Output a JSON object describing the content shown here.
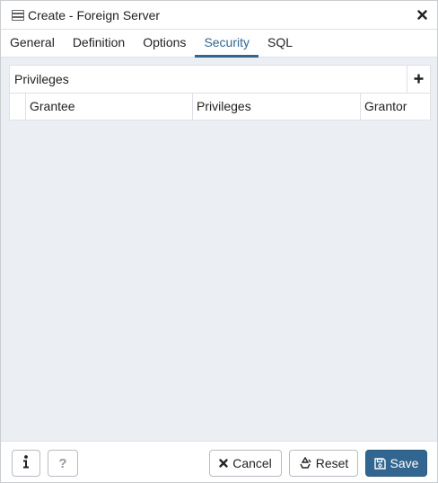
{
  "window": {
    "title": "Create - Foreign Server",
    "icon": "foreign-server-icon"
  },
  "tabs": [
    {
      "label": "General",
      "active": false
    },
    {
      "label": "Definition",
      "active": false
    },
    {
      "label": "Options",
      "active": false
    },
    {
      "label": "Security",
      "active": true
    },
    {
      "label": "SQL",
      "active": false
    }
  ],
  "privileges": {
    "title": "Privileges",
    "add_icon": "plus-icon",
    "columns": [
      "Grantee",
      "Privileges",
      "Grantor"
    ],
    "rows": []
  },
  "footer": {
    "info_icon": "info-icon",
    "help_label": "?",
    "cancel_label": "Cancel",
    "reset_label": "Reset",
    "save_label": "Save"
  },
  "colors": {
    "accent": "#326690",
    "content_bg": "#ebeef3",
    "border": "#dde0e6"
  }
}
